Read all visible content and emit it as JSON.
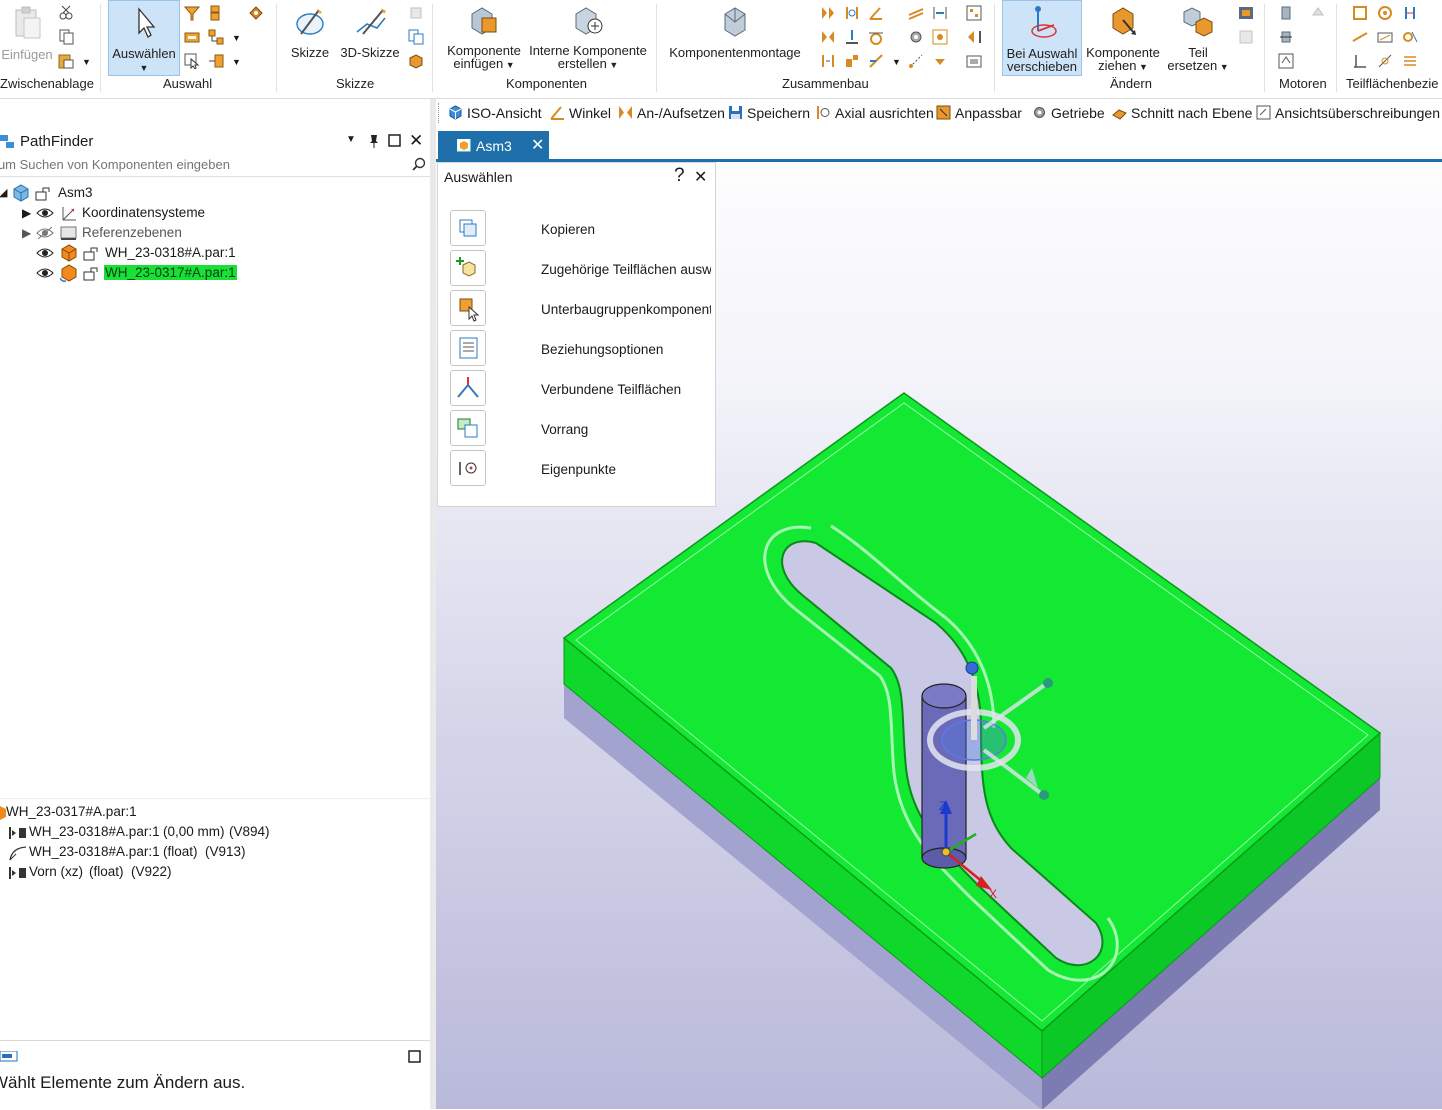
{
  "ribbon": {
    "groups": [
      "Zwischenablage",
      "Auswahl",
      "Skizze",
      "Komponenten",
      "Zusammenbau",
      "Ändern",
      "Motoren",
      "Teilflächenbezie"
    ],
    "paste": "Einfügen",
    "select": "Auswählen",
    "sketch": "Skizze",
    "sketch3d": "3D-Skizze",
    "insert_component_1": "Komponente",
    "insert_component_2": "einfügen",
    "create_internal_1": "Interne Komponente",
    "create_internal_2": "erstellen",
    "component_assembly": "Komponentenmontage",
    "move_on_select_1": "Bei Auswahl",
    "move_on_select_2": "verschieben",
    "drag_component_1": "Komponente",
    "drag_component_2": "ziehen",
    "replace_part_1": "Teil",
    "replace_part_2": "ersetzen"
  },
  "quickbar": [
    "ISO-Ansicht",
    "Winkel",
    "An-/Aufsetzen",
    "Speichern",
    "Axial ausrichten",
    "Anpassbar",
    "Getriebe",
    "Schnitt nach Ebene",
    "Ansichtsüberschreibungen"
  ],
  "pathfinder": {
    "title": "PathFinder",
    "search_placeholder": "Zum Suchen von Komponenten eingeben",
    "tree": [
      {
        "label": "Asm3"
      },
      {
        "label": "Koordinatensysteme"
      },
      {
        "label": "Referenzebenen"
      },
      {
        "label": "WH_23-0318#A.par:1"
      },
      {
        "label": "WH_23-0317#A.par:1"
      }
    ],
    "relations_header": "WH_23-0317#A.par:1",
    "relations": [
      {
        "target": "WH_23-0318#A.par:1",
        "value": "(0,00 mm)",
        "id": "(V894)"
      },
      {
        "target": "WH_23-0318#A.par:1",
        "value": "(float)",
        "id": "(V913)"
      },
      {
        "target": "Vorn (xz)",
        "value": "(float)",
        "id": "(V922)"
      }
    ],
    "status_text": "Wählt Elemente zum Ändern aus."
  },
  "document_tab": "Asm3",
  "select_panel": {
    "title": "Auswählen",
    "help": "?",
    "options": [
      "Kopieren",
      "Zugehörige Teilflächen auswählen",
      "Unterbaugruppenkomponenten",
      "Beziehungsoptionen",
      "Verbundene Teilflächen",
      "Vorrang",
      "Eigenpunkte"
    ]
  },
  "colors": {
    "highlight_green": "#19e036",
    "tab_blue": "#1f6faa",
    "active_button": "#cde3f7"
  }
}
